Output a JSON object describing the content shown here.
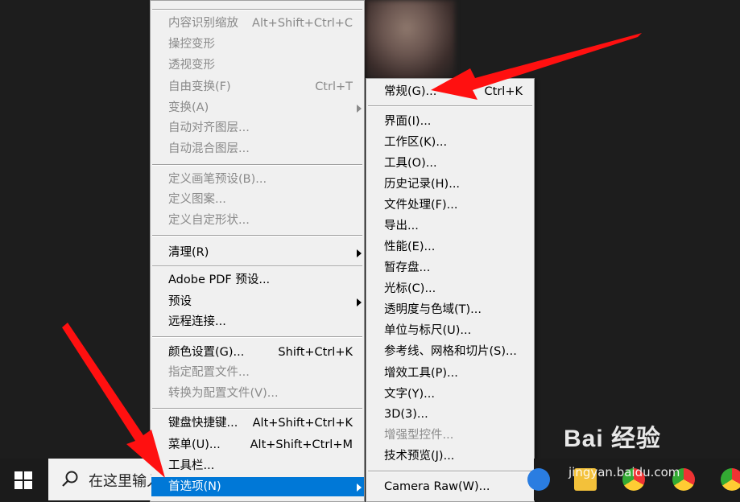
{
  "main_menu": {
    "items": [
      {
        "label": "内容识别缩放",
        "shortcut": "Alt+Shift+Ctrl+C",
        "disabled": true
      },
      {
        "label": "操控变形",
        "disabled": true
      },
      {
        "label": "透视变形",
        "disabled": true
      },
      {
        "label": "自由变换(F)",
        "shortcut": "Ctrl+T",
        "disabled": true
      },
      {
        "label": "变换(A)",
        "disabled": true
      },
      {
        "label": "自动对齐图层...",
        "disabled": true
      },
      {
        "label": "自动混合图层...",
        "disabled": true
      },
      {
        "label": "定义画笔预设(B)...",
        "disabled": true
      },
      {
        "label": "定义图案...",
        "disabled": true
      },
      {
        "label": "定义自定形状...",
        "disabled": true
      },
      {
        "label": "清理(R)"
      },
      {
        "label": "Adobe PDF 预设..."
      },
      {
        "label": "预设"
      },
      {
        "label": "远程连接..."
      },
      {
        "label": "颜色设置(G)...",
        "shortcut": "Shift+Ctrl+K"
      },
      {
        "label": "指定配置文件...",
        "disabled": true
      },
      {
        "label": "转换为配置文件(V)...",
        "disabled": true
      },
      {
        "label": "键盘快捷键...",
        "shortcut": "Alt+Shift+Ctrl+K"
      },
      {
        "label": "菜单(U)...",
        "shortcut": "Alt+Shift+Ctrl+M"
      },
      {
        "label": "工具栏..."
      },
      {
        "label": "首选项(N)",
        "highlighted": true
      }
    ]
  },
  "sub_menu": {
    "items": [
      {
        "label": "常规(G)...",
        "shortcut": "Ctrl+K"
      },
      {
        "label": "界面(I)..."
      },
      {
        "label": "工作区(K)..."
      },
      {
        "label": "工具(O)..."
      },
      {
        "label": "历史记录(H)..."
      },
      {
        "label": "文件处理(F)..."
      },
      {
        "label": "导出..."
      },
      {
        "label": "性能(E)..."
      },
      {
        "label": "暂存盘..."
      },
      {
        "label": "光标(C)..."
      },
      {
        "label": "透明度与色域(T)..."
      },
      {
        "label": "单位与标尺(U)..."
      },
      {
        "label": "参考线、网格和切片(S)..."
      },
      {
        "label": "增效工具(P)..."
      },
      {
        "label": "文字(Y)..."
      },
      {
        "label": "3D(3)..."
      },
      {
        "label": "增强型控件...",
        "disabled": true
      },
      {
        "label": "技术预览(J)..."
      },
      {
        "label": "Camera Raw(W)..."
      }
    ]
  },
  "taskbar": {
    "search_text": "在这里输入"
  },
  "watermark": {
    "brand": "Bai  经验",
    "url": "jingyan.baidu.com"
  },
  "colors": {
    "menu_bg": "#f0f0f0",
    "highlight": "#0078d7",
    "annotation_arrow": "#ff1010"
  }
}
